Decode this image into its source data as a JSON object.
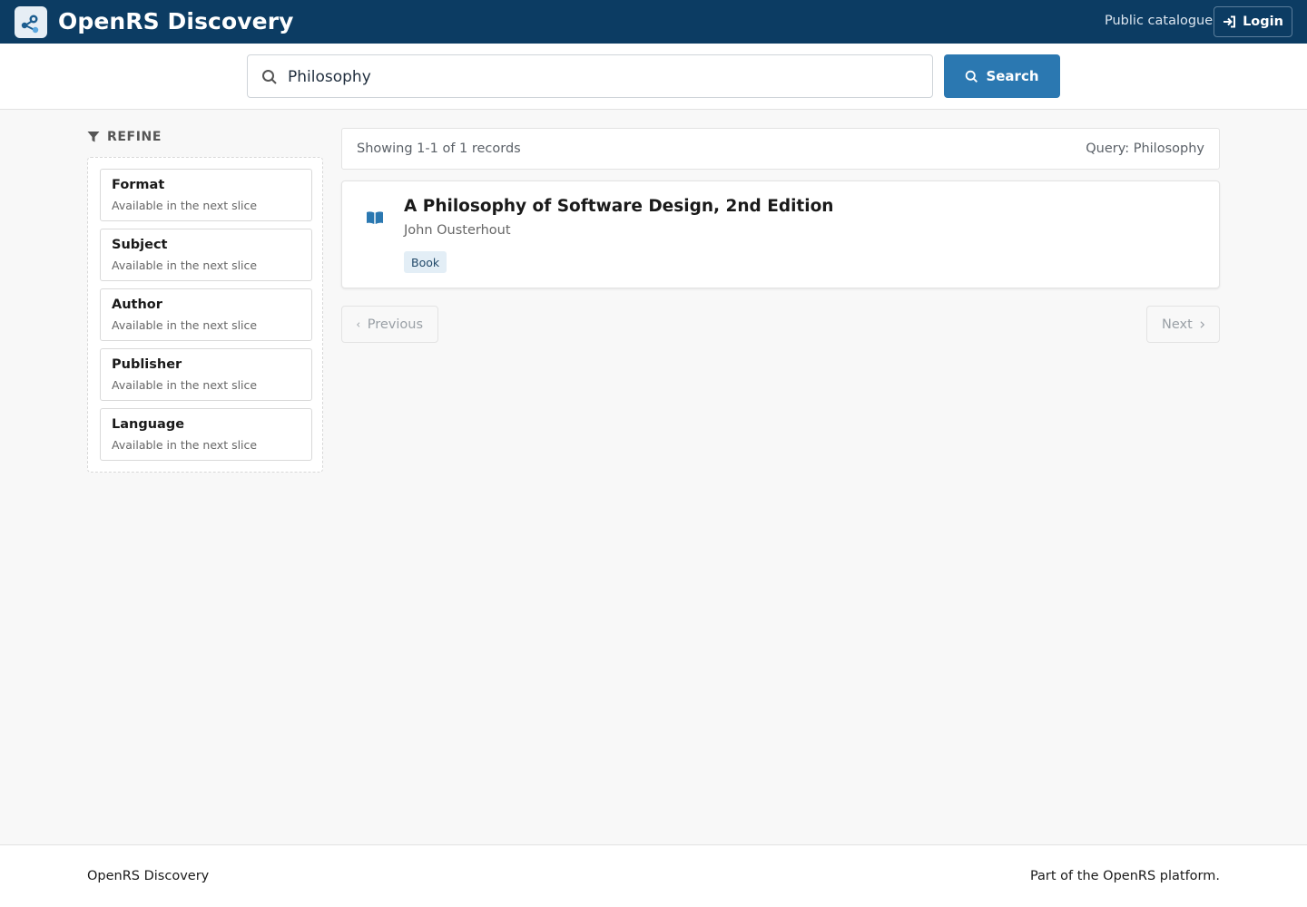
{
  "header": {
    "app_title": "OpenRS Discovery",
    "public_link": "Public catalogue",
    "login_label": "Login"
  },
  "search": {
    "value": "Philosophy",
    "button_label": "Search"
  },
  "refine": {
    "heading": "REFINE",
    "facets": [
      {
        "name": "Format",
        "note": "Available in the next slice"
      },
      {
        "name": "Subject",
        "note": "Available in the next slice"
      },
      {
        "name": "Author",
        "note": "Available in the next slice"
      },
      {
        "name": "Publisher",
        "note": "Available in the next slice"
      },
      {
        "name": "Language",
        "note": "Available in the next slice"
      }
    ]
  },
  "results": {
    "summary": "Showing 1-1 of 1 records",
    "query": "Query: Philosophy",
    "records": [
      {
        "title": "A Philosophy of Software Design, 2nd Edition",
        "author": "John Ousterhout",
        "format": "Book"
      }
    ]
  },
  "pager": {
    "previous": "Previous",
    "next": "Next"
  },
  "footer": {
    "left": "OpenRS Discovery",
    "right": "Part of the OpenRS platform."
  },
  "icons": {
    "logo": "share-nodes-icon",
    "login": "sign-in-icon",
    "search": "magnifier-icon",
    "refine": "filter-icon",
    "record": "open-book-icon",
    "previous": "chevron-left-icon",
    "next": "chevron-right-icon"
  },
  "colors": {
    "header_bg": "#0c3c63",
    "accent": "#2b78b1",
    "badge_bg": "#e3eef6"
  }
}
